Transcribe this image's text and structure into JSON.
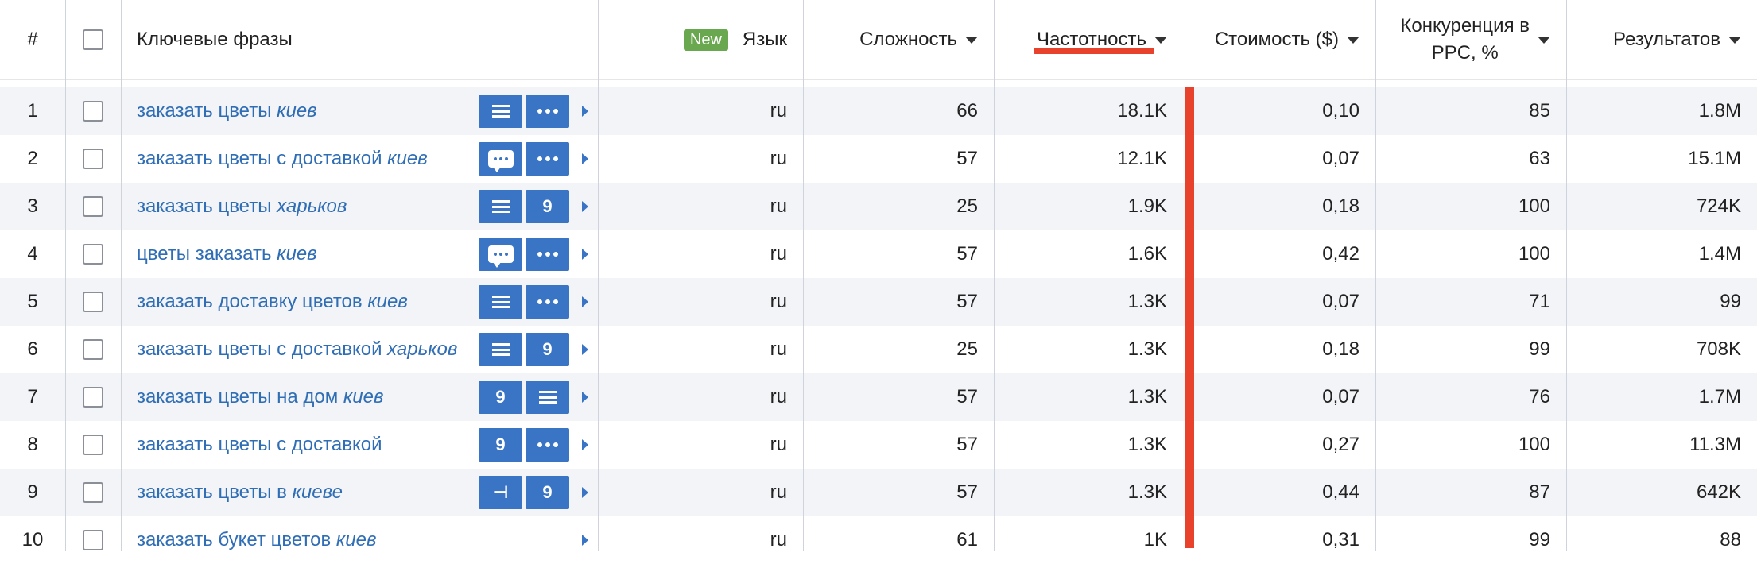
{
  "header": {
    "num": "#",
    "keywords": "Ключевые фразы",
    "new_badge": "New",
    "language": "Язык",
    "difficulty": "Сложность",
    "frequency": "Частотность",
    "cost": "Стоимость ($)",
    "competition_line1": "Конкуренция в",
    "competition_line2": "PPC, %",
    "results": "Результатов"
  },
  "colors": {
    "accent": "#3a74c4",
    "highlight": "#e8412c",
    "badge": "#6aa84f",
    "link": "#2f6db5"
  },
  "rows": [
    {
      "num": "1",
      "kw": "заказать цветы ",
      "city": "киев",
      "features": [
        "lines-icon",
        "dots-icon"
      ],
      "lang": "ru",
      "diff": "66",
      "freq": "18.1K",
      "cost": "0,10",
      "comp": "85",
      "res": "1.8M"
    },
    {
      "num": "2",
      "kw": "заказать цветы с доставкой ",
      "city": "киев",
      "features": [
        "chat-icon",
        "dots-icon"
      ],
      "lang": "ru",
      "diff": "57",
      "freq": "12.1K",
      "cost": "0,07",
      "comp": "63",
      "res": "15.1M"
    },
    {
      "num": "3",
      "kw": "заказать цветы ",
      "city": "харьков",
      "features": [
        "lines-icon",
        "map-pin-icon"
      ],
      "lang": "ru",
      "diff": "25",
      "freq": "1.9K",
      "cost": "0,18",
      "comp": "100",
      "res": "724K"
    },
    {
      "num": "4",
      "kw": "цветы заказать ",
      "city": "киев",
      "features": [
        "chat-icon",
        "dots-icon"
      ],
      "lang": "ru",
      "diff": "57",
      "freq": "1.6K",
      "cost": "0,42",
      "comp": "100",
      "res": "1.4M"
    },
    {
      "num": "5",
      "kw": "заказать доставку цветов ",
      "city": "киев",
      "features": [
        "lines-icon",
        "dots-icon"
      ],
      "lang": "ru",
      "diff": "57",
      "freq": "1.3K",
      "cost": "0,07",
      "comp": "71",
      "res": "99"
    },
    {
      "num": "6",
      "kw": "заказать цветы с доставкой ",
      "city": "харьков",
      "features": [
        "lines-icon",
        "map-pin-icon"
      ],
      "lang": "ru",
      "diff": "25",
      "freq": "1.3K",
      "cost": "0,18",
      "comp": "99",
      "res": "708K"
    },
    {
      "num": "7",
      "kw": "заказать цветы на дом ",
      "city": "киев",
      "features": [
        "map-pin-icon",
        "lines-icon"
      ],
      "lang": "ru",
      "diff": "57",
      "freq": "1.3K",
      "cost": "0,07",
      "comp": "76",
      "res": "1.7M"
    },
    {
      "num": "8",
      "kw": "заказать цветы с доставкой",
      "city": "",
      "features": [
        "map-pin-icon",
        "dots-icon"
      ],
      "lang": "ru",
      "diff": "57",
      "freq": "1.3K",
      "cost": "0,27",
      "comp": "100",
      "res": "11.3M"
    },
    {
      "num": "9",
      "kw": "заказать цветы в ",
      "city": "киеве",
      "features": [
        "signpost-icon",
        "map-pin-icon"
      ],
      "lang": "ru",
      "diff": "57",
      "freq": "1.3K",
      "cost": "0,44",
      "comp": "87",
      "res": "642K"
    },
    {
      "num": "10",
      "kw": "заказать букет цветов ",
      "city": "киев",
      "features": [],
      "lang": "ru",
      "diff": "61",
      "freq": "1K",
      "cost": "0,31",
      "comp": "99",
      "res": "88"
    }
  ]
}
